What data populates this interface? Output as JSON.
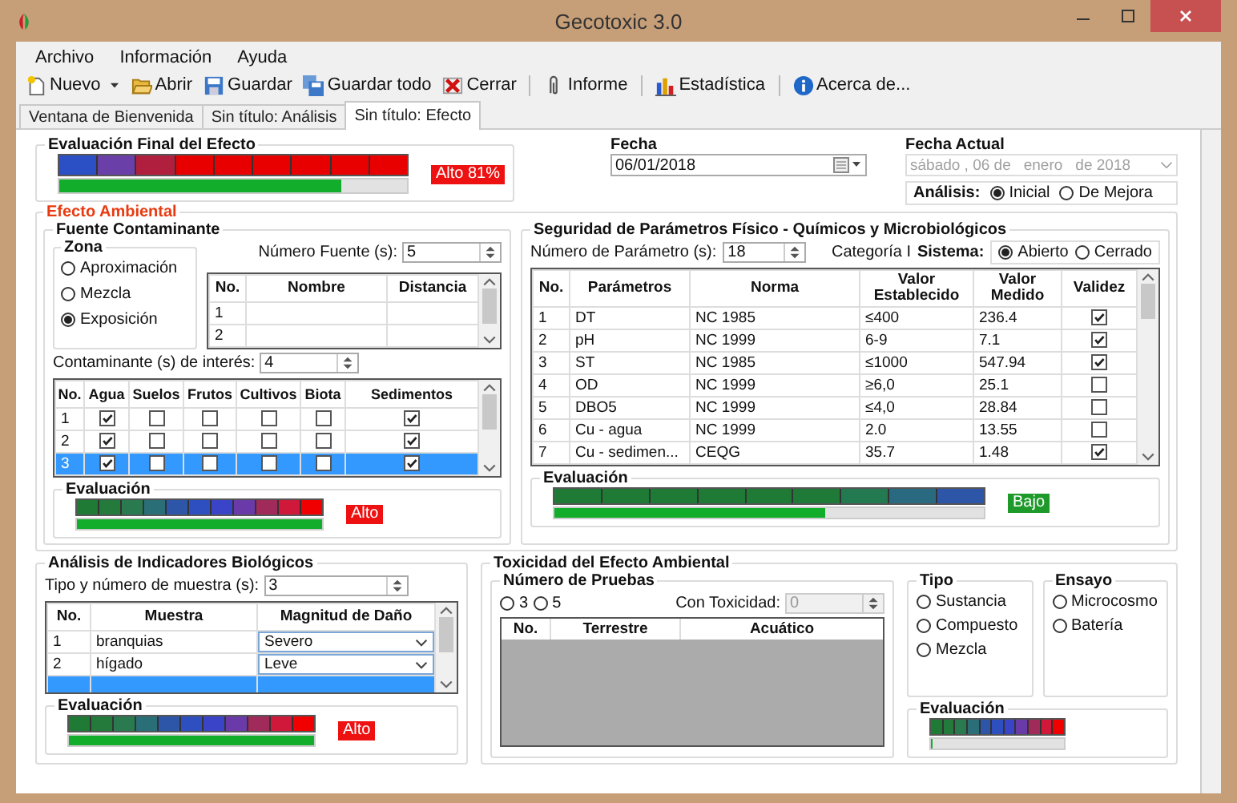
{
  "window": {
    "title": "Gecotoxic 3.0"
  },
  "menu": [
    {
      "label": "Archivo"
    },
    {
      "label": "Información"
    },
    {
      "label": "Ayuda"
    }
  ],
  "toolbar": [
    {
      "label": "Nuevo",
      "dropdown": true,
      "separator_before": false
    },
    {
      "label": "Abrir",
      "dropdown": false,
      "separator_before": false
    },
    {
      "label": "Guardar",
      "dropdown": false,
      "separator_before": false
    },
    {
      "label": "Guardar todo",
      "dropdown": false,
      "separator_before": false
    },
    {
      "label": "Cerrar",
      "dropdown": false,
      "separator_before": false
    },
    {
      "label": "Informe",
      "dropdown": false,
      "separator_before": true
    },
    {
      "label": "Estadística",
      "dropdown": false,
      "separator_before": true
    },
    {
      "label": "Acerca de...",
      "dropdown": false,
      "separator_before": true
    }
  ],
  "tabs": [
    {
      "label": "Ventana de Bienvenida",
      "selected": false
    },
    {
      "label": "Sin título: Análisis",
      "selected": false
    },
    {
      "label": "Sin título: Efecto",
      "selected": true
    }
  ],
  "final_evaluation": {
    "title": "Evaluación Final del Efecto",
    "level": 0.81,
    "badge": {
      "text": "Alto 81%",
      "kind": "high"
    }
  },
  "fecha": {
    "label": "Fecha",
    "value": "06/01/2018"
  },
  "fecha_actual": {
    "label": "Fecha Actual",
    "parts": [
      "sábado , 06 de",
      "enero",
      "de 2018"
    ],
    "disabled": true
  },
  "analisis": {
    "label": "Análisis:",
    "options": [
      {
        "label": "Inicial",
        "selected": true
      },
      {
        "label": "De Mejora",
        "selected": false
      }
    ]
  },
  "efecto_ambiental": {
    "title": "Efecto Ambiental",
    "fuente": {
      "title": "Fuente Contaminante",
      "zona": {
        "title": "Zona",
        "options": [
          {
            "label": "Aproximación",
            "selected": false
          },
          {
            "label": "Mezcla",
            "selected": false
          },
          {
            "label": "Exposición",
            "selected": true
          }
        ]
      },
      "numero_fuente": {
        "label": "Número Fuente (s):",
        "value": "5"
      },
      "fuentes_table": {
        "columns": [
          "No.",
          "Nombre",
          "Distancia"
        ],
        "rows": [
          {
            "no": "1"
          },
          {
            "no": "2"
          }
        ]
      },
      "contaminantes": {
        "label": "Contaminante (s) de interés:",
        "value": "4"
      },
      "contaminantes_table": {
        "columns": [
          "No.",
          "Agua",
          "Suelos",
          "Frutos",
          "Cultivos",
          "Biota",
          "Sedimentos"
        ],
        "rows": [
          {
            "no": "1",
            "checks": [
              true,
              false,
              false,
              false,
              false,
              true
            ],
            "selected": false
          },
          {
            "no": "2",
            "checks": [
              true,
              false,
              false,
              false,
              false,
              true
            ],
            "selected": false
          },
          {
            "no": "3",
            "checks": [
              true,
              false,
              false,
              false,
              false,
              true
            ],
            "selected": true
          }
        ]
      },
      "evaluation": {
        "title": "Evaluación",
        "level": 1,
        "badge": {
          "text": "Alto",
          "kind": "high"
        }
      }
    },
    "seguridad": {
      "title": "Seguridad de Parámetros Físico - Químicos y Microbiológicos",
      "numero": {
        "label": "Número de Parámetro (s):",
        "value": "18"
      },
      "categoria": "Categoría I",
      "sistema": {
        "label": "Sistema:",
        "options": [
          {
            "label": "Abierto",
            "selected": true
          },
          {
            "label": "Cerrado",
            "selected": false
          }
        ]
      },
      "table": {
        "columns": [
          "No.",
          "Parámetros",
          "Norma",
          "Valor Establecido",
          "Valor Medido",
          "Validez"
        ],
        "rows": [
          {
            "no": "1",
            "parametro": "DT",
            "norma": "NC 1985",
            "establecido": "≤400",
            "medido": "236.4",
            "valid": true
          },
          {
            "no": "2",
            "parametro": "pH",
            "norma": "NC 1999",
            "establecido": "6-9",
            "medido": "7.1",
            "valid": true
          },
          {
            "no": "3",
            "parametro": "ST",
            "norma": "NC 1985",
            "establecido": "≤1000",
            "medido": "547.94",
            "valid": true
          },
          {
            "no": "4",
            "parametro": "OD",
            "norma": "NC 1999",
            "establecido": "≥6,0",
            "medido": "25.1",
            "valid": false
          },
          {
            "no": "5",
            "parametro": "DBO5",
            "norma": "NC 1999",
            "establecido": "≤4,0",
            "medido": "28.84",
            "valid": false
          },
          {
            "no": "6",
            "parametro": " Cu - agua",
            "norma": "NC 1999",
            "establecido": "2.0",
            "medido": "13.55",
            "valid": false
          },
          {
            "no": "7",
            "parametro": "Cu - sedimen...",
            "norma": "CEQG",
            "establecido": "35.7",
            "medido": "1.48",
            "valid": true
          }
        ]
      },
      "evaluation": {
        "title": "Evaluación",
        "level": 0.63,
        "badge": {
          "text": "Bajo",
          "kind": "low"
        }
      }
    }
  },
  "indicadores": {
    "title": "Análisis de Indicadores Biológicos",
    "muestra": {
      "label": "Tipo y número de muestra (s):",
      "value": "3"
    },
    "table": {
      "columns": [
        "No.",
        "Muestra",
        "Magnitud de Daño"
      ],
      "rows": [
        {
          "no": "1",
          "muestra": "branquias",
          "dano": "Severo",
          "selected": false
        },
        {
          "no": "2",
          "muestra": "hígado",
          "dano": "Leve",
          "selected": false
        },
        {
          "selected": true
        }
      ]
    },
    "evaluation": {
      "title": "Evaluación",
      "level": 1,
      "badge": {
        "text": "Alto",
        "kind": "high"
      }
    }
  },
  "toxicidad": {
    "title": "Toxicidad del Efecto Ambiental",
    "pruebas": {
      "title": "Número de Pruebas",
      "options": [
        {
          "label": "3",
          "selected": false
        },
        {
          "label": "5",
          "selected": false
        }
      ],
      "con_toxicidad": {
        "label": "Con Toxicidad:",
        "value": "0",
        "disabled": true
      },
      "table": {
        "columns": [
          "No.",
          "Terrestre",
          "Acuático"
        ]
      }
    },
    "tipo": {
      "title": "Tipo",
      "options": [
        {
          "label": "Sustancia",
          "selected": false
        },
        {
          "label": "Compuesto",
          "selected": false
        },
        {
          "label": "Mezcla",
          "selected": false
        }
      ]
    },
    "ensayo": {
      "title": "Ensayo",
      "options": [
        {
          "label": "Microcosmo",
          "selected": false
        },
        {
          "label": "Batería",
          "selected": false
        }
      ]
    },
    "evaluation": {
      "title": "Evaluación",
      "level": 0
    }
  }
}
